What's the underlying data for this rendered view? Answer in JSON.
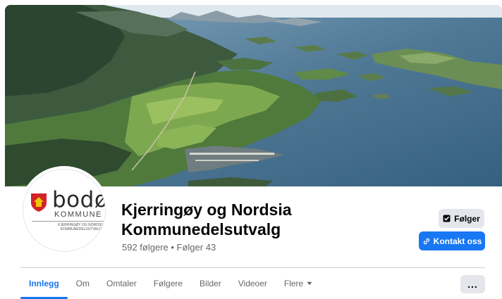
{
  "page": {
    "title": "Kjerringøy og Nordsia Kommunedelsutvalg",
    "stats": "592 følgere • Følger 43"
  },
  "logo": {
    "word": "bodø",
    "sub": "KOMMUNE",
    "small": "KJERRINGØY OG NORDSIA KOMMUNEDELSUTVALG"
  },
  "actions": {
    "follow_label": "Følger",
    "contact_label": "Kontakt oss",
    "more_label": "..."
  },
  "tabs": [
    {
      "label": "Innlegg",
      "active": true
    },
    {
      "label": "Om"
    },
    {
      "label": "Omtaler"
    },
    {
      "label": "Følgere"
    },
    {
      "label": "Bilder"
    },
    {
      "label": "Videoer"
    },
    {
      "label": "Flere"
    }
  ],
  "colors": {
    "accent": "#1877f2",
    "secondary_button": "#e4e6eb",
    "muted_text": "#65676b"
  },
  "icons": {
    "follow": "follow-check-icon",
    "contact": "link-icon",
    "more_caret": "caret-down-icon"
  }
}
